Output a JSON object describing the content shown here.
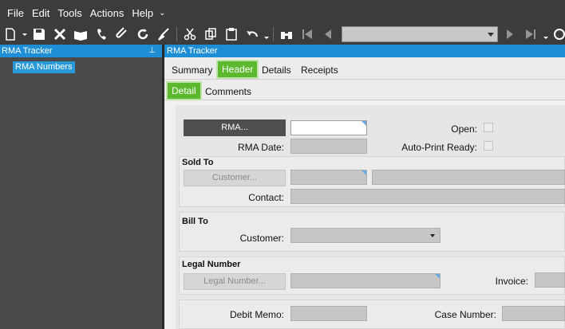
{
  "menu": [
    "File",
    "Edit",
    "Tools",
    "Actions",
    "Help"
  ],
  "menu_overflow": "⌄",
  "toolbar_icons": [
    "new-icon",
    "new-dropdown-icon",
    "save-icon",
    "delete-icon",
    "book-icon",
    "phone-icon",
    "attach-icon",
    "refresh-icon",
    "clear-icon",
    "cut-icon",
    "copy-icon",
    "paste-icon",
    "undo-icon",
    "binoculars-icon",
    "first-record-icon",
    "prev-record-icon",
    "next-record-icon",
    "last-record-icon",
    "clock-icon"
  ],
  "left_panel": {
    "title": "RMA Tracker",
    "tree_item": "RMA Numbers"
  },
  "right_panel": {
    "title": "RMA Tracker"
  },
  "tabs": [
    "Summary",
    "Header",
    "Details",
    "Receipts"
  ],
  "active_tab": "Header",
  "subtabs": [
    "Detail",
    "Comments"
  ],
  "active_subtab": "Detail",
  "form": {
    "rma_button": "RMA...",
    "rma_value": "",
    "rma_date_label": "RMA Date:",
    "open_label": "Open:",
    "auto_print_label": "Auto-Print Ready:",
    "sold_to_header": "Sold To",
    "sold_customer_button": "Customer...",
    "contact_label": "Contact:",
    "bill_to_header": "Bill To",
    "bill_customer_label": "Customer:",
    "legal_number_header": "Legal Number",
    "legal_number_button": "Legal Number...",
    "invoice_label": "Invoice:",
    "debit_memo_label": "Debit Memo:",
    "case_number_label": "Case Number:"
  },
  "colors": {
    "accent_blue": "#1e8fd6",
    "tab_green": "#5cb82e",
    "chrome": "#3c3c3c"
  }
}
